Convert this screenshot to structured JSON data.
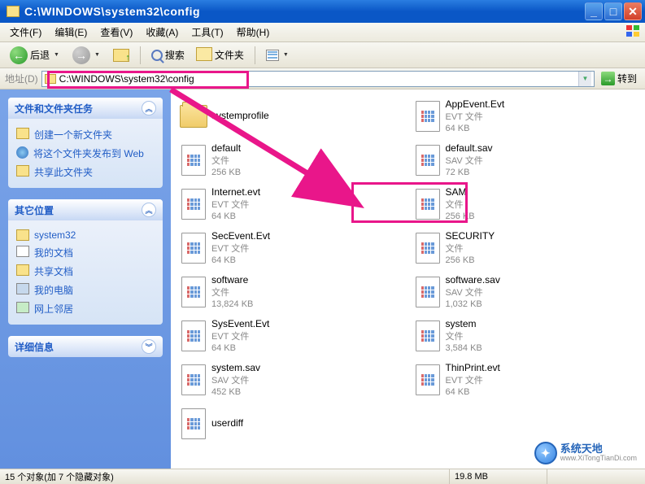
{
  "window": {
    "title": "C:\\WINDOWS\\system32\\config"
  },
  "menu": {
    "file": "文件(F)",
    "edit": "编辑(E)",
    "view": "查看(V)",
    "favorites": "收藏(A)",
    "tools": "工具(T)",
    "help": "帮助(H)"
  },
  "toolbar": {
    "back": "后退",
    "search": "搜索",
    "folders": "文件夹"
  },
  "addressbar": {
    "label": "地址(D)",
    "path": "C:\\WINDOWS\\system32\\config",
    "go": "转到"
  },
  "sidebar": {
    "tasks": {
      "header": "文件和文件夹任务",
      "items": [
        "创建一个新文件夹",
        "将这个文件夹发布到 Web",
        "共享此文件夹"
      ]
    },
    "places": {
      "header": "其它位置",
      "items": [
        "system32",
        "我的文档",
        "共享文档",
        "我的电脑",
        "网上邻居"
      ]
    },
    "details": {
      "header": "详细信息"
    }
  },
  "files": [
    {
      "name": "systemprofile",
      "type": "",
      "size": "",
      "kind": "folder"
    },
    {
      "name": "AppEvent.Evt",
      "type": "EVT 文件",
      "size": "64 KB",
      "kind": "evt"
    },
    {
      "name": "default",
      "type": "文件",
      "size": "256 KB",
      "kind": "file"
    },
    {
      "name": "default.sav",
      "type": "SAV 文件",
      "size": "72 KB",
      "kind": "sav"
    },
    {
      "name": "Internet.evt",
      "type": "EVT 文件",
      "size": "64 KB",
      "kind": "evt"
    },
    {
      "name": "SAM",
      "type": "文件",
      "size": "256 KB",
      "kind": "file"
    },
    {
      "name": "SecEvent.Evt",
      "type": "EVT 文件",
      "size": "64 KB",
      "kind": "evt"
    },
    {
      "name": "SECURITY",
      "type": "文件",
      "size": "256 KB",
      "kind": "file"
    },
    {
      "name": "software",
      "type": "文件",
      "size": "13,824 KB",
      "kind": "file"
    },
    {
      "name": "software.sav",
      "type": "SAV 文件",
      "size": "1,032 KB",
      "kind": "sav"
    },
    {
      "name": "SysEvent.Evt",
      "type": "EVT 文件",
      "size": "64 KB",
      "kind": "evt"
    },
    {
      "name": "system",
      "type": "文件",
      "size": "3,584 KB",
      "kind": "file"
    },
    {
      "name": "system.sav",
      "type": "SAV 文件",
      "size": "452 KB",
      "kind": "sav"
    },
    {
      "name": "ThinPrint.evt",
      "type": "EVT 文件",
      "size": "64 KB",
      "kind": "evt"
    },
    {
      "name": "userdiff",
      "type": "",
      "size": "",
      "kind": "file"
    }
  ],
  "status": {
    "left": "15 个对象(加 7 个隐藏对象)",
    "size": "19.8 MB"
  },
  "watermark": {
    "name": "系统天地",
    "url": "www.XiTongTianDi.com"
  }
}
